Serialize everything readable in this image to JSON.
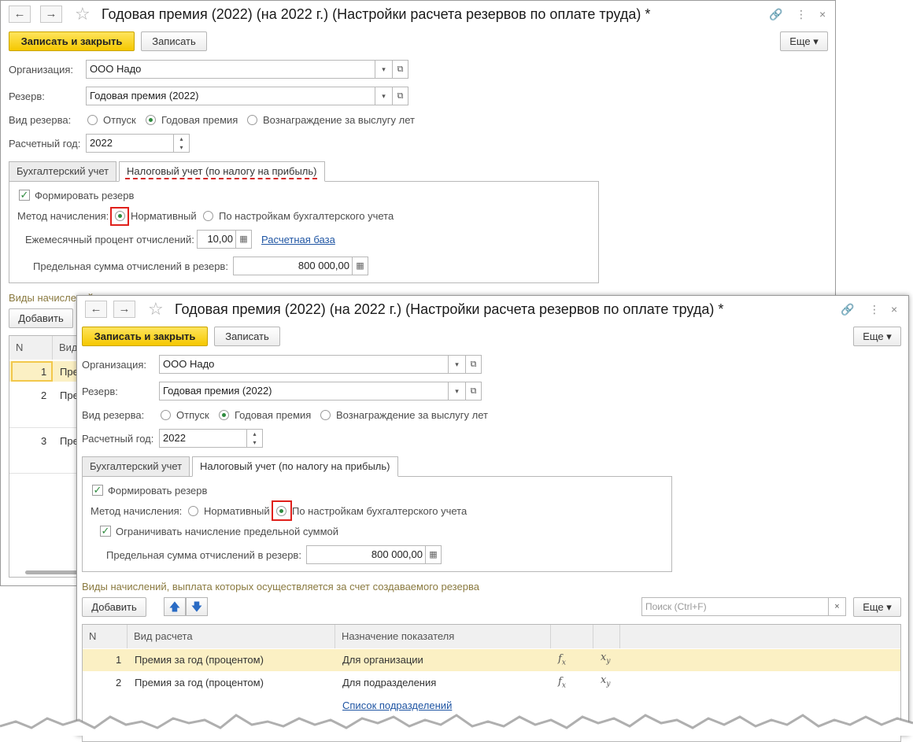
{
  "window": {
    "title": "Годовая премия (2022) (на 2022 г.) (Настройки расчета резервов по оплате труда) *",
    "back_icon": "←",
    "forward_icon": "→"
  },
  "toolbar": {
    "save_close": "Записать и закрыть",
    "save": "Записать",
    "more": "Еще"
  },
  "form": {
    "org_label": "Организация:",
    "org_value": "ООО Надо",
    "reserve_label": "Резерв:",
    "reserve_value": "Годовая премия (2022)",
    "kind_label": "Вид резерва:",
    "kind_options": [
      "Отпуск",
      "Годовая премия",
      "Вознаграждение за выслугу лет"
    ],
    "year_label": "Расчетный год:",
    "year_value": "2022"
  },
  "tabs": [
    "Бухгалтерский учет",
    "Налоговый учет (по налогу на прибыль)"
  ],
  "tax": {
    "form_reserve": "Формировать резерв",
    "method_label": "Метод начисления:",
    "method_options": [
      "Нормативный",
      "По настройкам бухгалтерского учета"
    ],
    "monthly_label": "Ежемесячный процент отчислений:",
    "monthly_value": "10,00",
    "base_link": "Расчетная база",
    "limit_label": "Предельная сумма отчислений в резерв:",
    "limit_value": "800 000,00",
    "limit_check": "Ограничивать начисление предельной суммой"
  },
  "accruals": {
    "section_title": "Виды начислений, выплата которых осуществляется за счет создаваемого резерва",
    "section_title_cut": "Виды начислений",
    "add": "Добавить",
    "search_placeholder": "Поиск (Ctrl+F)",
    "more": "Еще",
    "headers": [
      "N",
      "Вид расчета",
      "Назначение показателя"
    ],
    "header_cut": "Вид",
    "rows": [
      {
        "n": "1",
        "kind": "Премия за год (процентом)",
        "purpose": "Для организации"
      },
      {
        "n": "2",
        "kind": "Премия за год (процентом)",
        "purpose": "Для подразделения",
        "link": "Список подразделений"
      },
      {
        "n": "3",
        "kind": "Пре"
      }
    ],
    "row_cut": "Пре",
    "fx": "fx",
    "xy": "xy"
  }
}
